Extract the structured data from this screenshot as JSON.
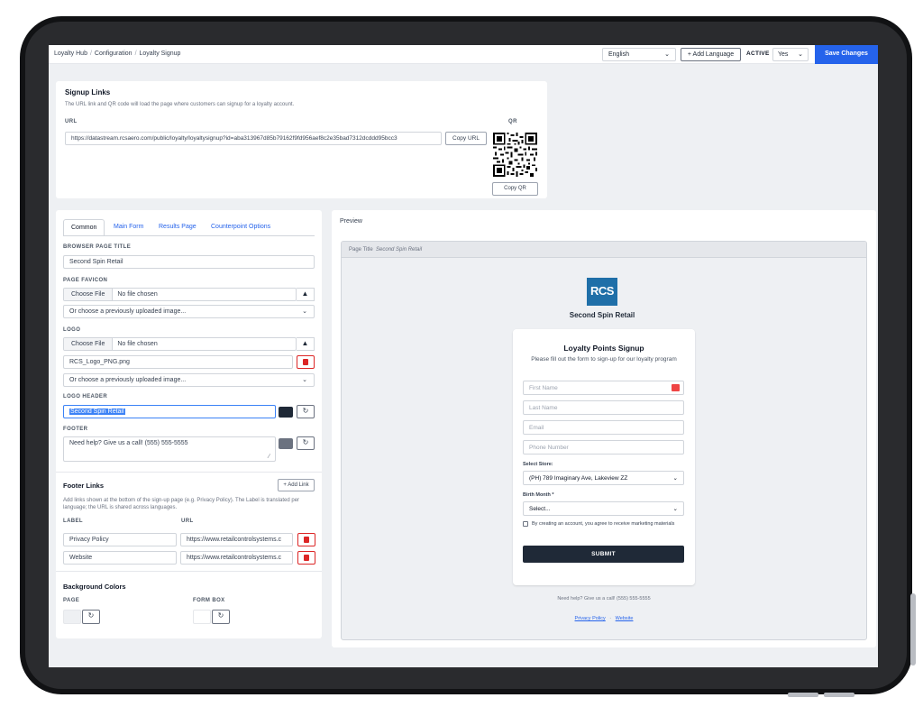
{
  "breadcrumb": [
    "Loyalty Hub",
    "Configuration",
    "Loyalty Signup"
  ],
  "breadcrumb_sep": "/",
  "header": {
    "language": "English",
    "add_language": "+ Add Language",
    "active_label": "ACTIVE",
    "active_value": "Yes",
    "save_label": "Save Changes"
  },
  "signup_links": {
    "title": "Signup Links",
    "description": "The URL link and QR code will load the page where customers can signup for a loyalty account.",
    "url_label": "URL",
    "url_value": "https://datastream.rcsaero.com/public/loyalty/loyaltysignup?id=aba313967d85b79162f9fd956aef8c2e35bad7312dcddd95bcc3",
    "copy_url": "Copy URL",
    "qr_label": "QR",
    "copy_qr": "Copy QR"
  },
  "tabs": [
    "Common",
    "Main Form",
    "Results Page",
    "Counterpoint Options"
  ],
  "common": {
    "browser_title_label": "BROWSER PAGE TITLE",
    "browser_title_value": "Second Spin Retail",
    "favicon_label": "PAGE FAVICON",
    "choose_file": "Choose File",
    "no_file": "No file chosen",
    "previous_image": "Or choose a previously uploaded image...",
    "logo_label": "LOGO",
    "logo_file": "RCS_Logo_PNG.png",
    "logo_header_label": "LOGO HEADER",
    "logo_header_value": "Second Spin Retail",
    "logo_header_color": "#1f2937",
    "footer_label": "FOOTER",
    "footer_value": "Need help? Give us a call! (555) 555-5555",
    "footer_color": "#6b7280"
  },
  "footer_links": {
    "title": "Footer Links",
    "add_link": "+ Add Link",
    "description": "Add links shown at the bottom of the sign-up page (e.g. Privacy Policy). The Label is translated per language; the URL is shared across languages.",
    "label_col": "LABEL",
    "url_col": "URL",
    "rows": [
      {
        "label": "Privacy Policy",
        "url": "https://www.retailcontrolsystems.c"
      },
      {
        "label": "Website",
        "url": "https://www.retailcontrolsystems.c"
      }
    ]
  },
  "background_colors": {
    "title": "Background Colors",
    "page_label": "PAGE",
    "form_box_label": "FORM BOX",
    "page_color": "#eef0f3",
    "form_box_color": "#ffffff"
  },
  "preview": {
    "label": "Preview",
    "page_title_label": "Page Title",
    "page_title_value": "Second Spin Retail",
    "logo_text": "RCS",
    "store_name": "Second Spin Retail",
    "form_title": "Loyalty Points Signup",
    "form_subtitle": "Please fill out the form to sign-up for our loyalty program",
    "first_name": "First Name",
    "last_name": "Last Name",
    "email": "Email",
    "phone": "Phone Number",
    "select_store_label": "Select Store:",
    "select_store_value": "(PH) 789 Imaginary Ave, Lakeview ZZ",
    "birth_month_label": "Birth Month *",
    "birth_month_value": "Select...",
    "consent": "By creating an account, you agree to receive marketing materials",
    "submit": "SUBMIT",
    "footer": "Need help? Give us a call! (555) 555-5555",
    "links": [
      "Privacy Policy",
      "Website"
    ],
    "link_sep": "·"
  },
  "colors": {
    "accent": "#2563eb",
    "danger": "#dc2626",
    "logo_bg": "#1f6fa8"
  }
}
